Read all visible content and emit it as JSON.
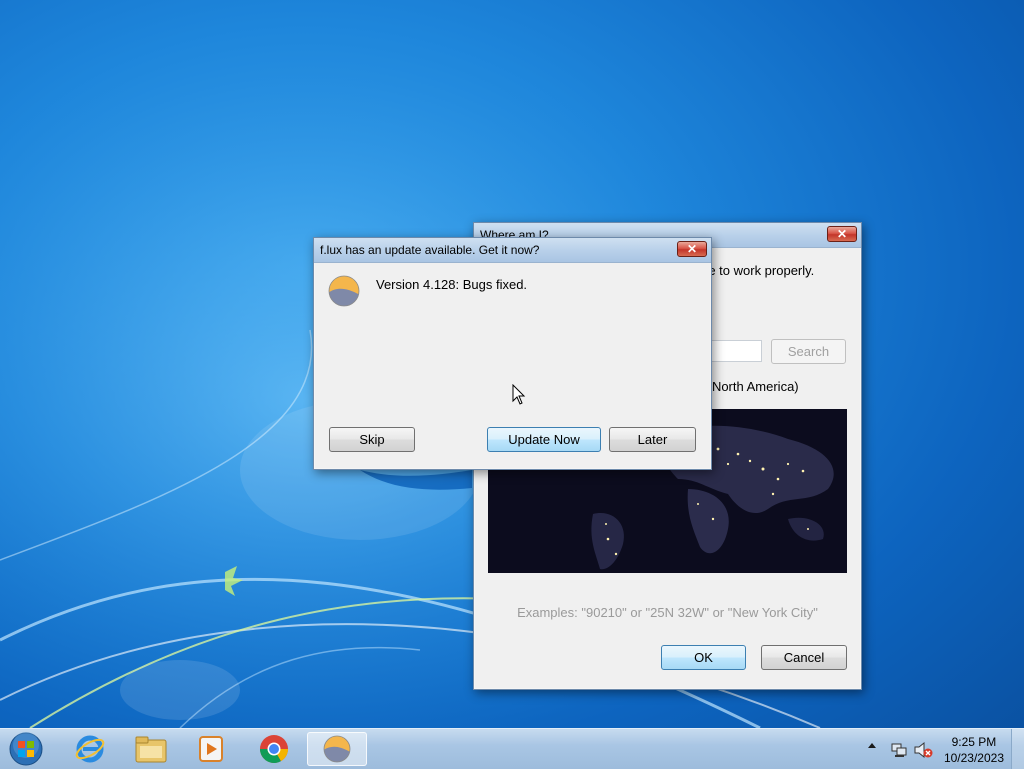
{
  "colors": {
    "accent": "#3c7fb1",
    "close": "#c3352a",
    "desktop": "#1e86db"
  },
  "location_dialog": {
    "title": "Where am I?",
    "instructions_visible": "re to work properly.",
    "search_label": "Search",
    "hint_visible": "r North America)",
    "examples": "Examples: \"90210\" or \"25N 32W\" or \"New York City\"",
    "ok_label": "OK",
    "cancel_label": "Cancel",
    "close_glyph": "✕"
  },
  "update_dialog": {
    "title": "f.lux has an update available. Get it now?",
    "message": "Version 4.128: Bugs fixed.",
    "skip_label": "Skip",
    "update_label": "Update Now",
    "later_label": "Later",
    "close_glyph": "✕"
  },
  "taskbar": {
    "icons": [
      "start-orb-icon",
      "internet-explorer-icon",
      "file-explorer-icon",
      "media-player-icon",
      "chrome-icon",
      "flux-icon"
    ],
    "time": "9:25 PM",
    "date": "10/23/2023"
  }
}
